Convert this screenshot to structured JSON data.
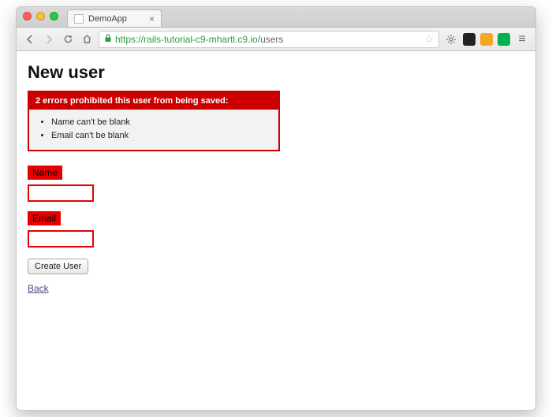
{
  "browser": {
    "tab_title": "DemoApp",
    "url_protocol": "https://",
    "url_host": "rails-tutorial-c9-mhartl.c9.io",
    "url_path": "/users"
  },
  "page": {
    "heading": "New user"
  },
  "errors": {
    "header": "2 errors prohibited this user from being saved:",
    "messages": [
      "Name can't be blank",
      "Email can't be blank"
    ]
  },
  "form": {
    "name_label": "Name",
    "name_value": "",
    "email_label": "Email",
    "email_value": "",
    "submit_label": "Create User"
  },
  "links": {
    "back": "Back"
  }
}
